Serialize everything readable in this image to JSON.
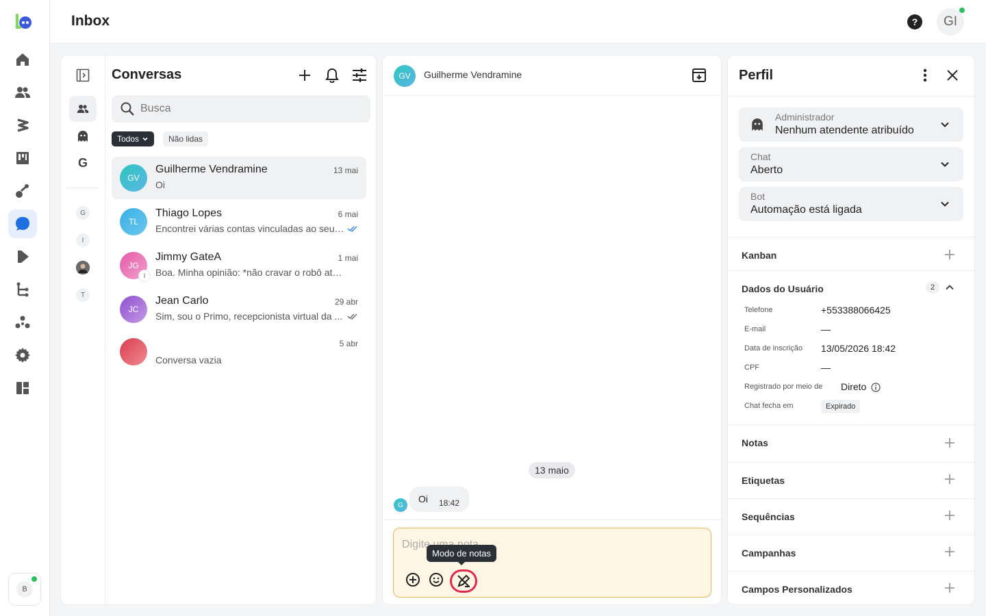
{
  "header": {
    "title": "Inbox",
    "user_initials": "GI",
    "help_icon": "?"
  },
  "rail": {
    "icons": [
      "home-icon",
      "contacts-icon",
      "lightning-icon",
      "kanban-icon",
      "broadcast-icon",
      "chat-icon",
      "play-icon",
      "flow-icon",
      "integrations-icon",
      "settings-icon",
      "dashboard-icon"
    ],
    "active": "chat-icon",
    "user_initial": "B"
  },
  "inbox_filters": {
    "letter_g": "G",
    "agents": [
      "G",
      "I",
      "T"
    ]
  },
  "conversations": {
    "title": "Conversas",
    "search_placeholder": "Busca",
    "filter_all": "Todos",
    "filter_unread": "Não lidas",
    "items": [
      {
        "initials": "GV",
        "name": "Guilherme Vendramine",
        "date": "13 mai",
        "preview": "Oi",
        "color": "#3cc5c7"
      },
      {
        "initials": "TL",
        "name": "Thiago Lopes",
        "date": "6 mai",
        "preview": "Encontrei várias contas vinculadas ao seu ...",
        "color": "#4fb0e6"
      },
      {
        "initials": "JG",
        "name": "Jimmy GateA",
        "date": "1 mai",
        "preview": "Boa. Minha opinião: *não cravar o robô atual c...",
        "badge": "I",
        "color": "#e86cb0"
      },
      {
        "initials": "JC",
        "name": "Jean Carlo",
        "date": "29 abr",
        "preview": "Sim, sou o Primo, recepcionista virtual da ...",
        "color": "#9b59d0"
      },
      {
        "initials": "",
        "name": "",
        "date": "5 abr",
        "preview": "Conversa vazia",
        "color": "#e0505e"
      }
    ]
  },
  "chat": {
    "contact_initials": "GV",
    "contact_name": "Guilherme Vendramine",
    "date_separator": "13 maio",
    "message_avatar": "G",
    "message_text": "Oi",
    "message_time": "18:42",
    "composer_placeholder": "Digite uma nota",
    "tooltip": "Modo de notas"
  },
  "profile": {
    "title": "Perfil",
    "assignee_label": "Administrador",
    "assignee_value": "Nenhum atendente atribuído",
    "chat_label": "Chat",
    "chat_value": "Aberto",
    "bot_label": "Bot",
    "bot_value": "Automação está ligada",
    "sections": {
      "kanban": "Kanban",
      "user_data": "Dados do Usuário",
      "user_data_count": "2",
      "notes": "Notas",
      "tags": "Etiquetas",
      "sequences": "Sequências",
      "campaigns": "Campanhas",
      "custom_fields": "Campos Personalizados"
    },
    "fields": {
      "phone_label": "Telefone",
      "phone_value": "+553388066425",
      "email_label": "E-mail",
      "email_value": "—",
      "signup_label": "Data de inscrição",
      "signup_value": "13/05/2026 18:42",
      "cpf_label": "CPF",
      "cpf_value": "—",
      "registered_label": "Registrado por meio de",
      "registered_value": "Direto",
      "closes_label": "Chat fecha em",
      "closes_value": "Expirado"
    }
  }
}
